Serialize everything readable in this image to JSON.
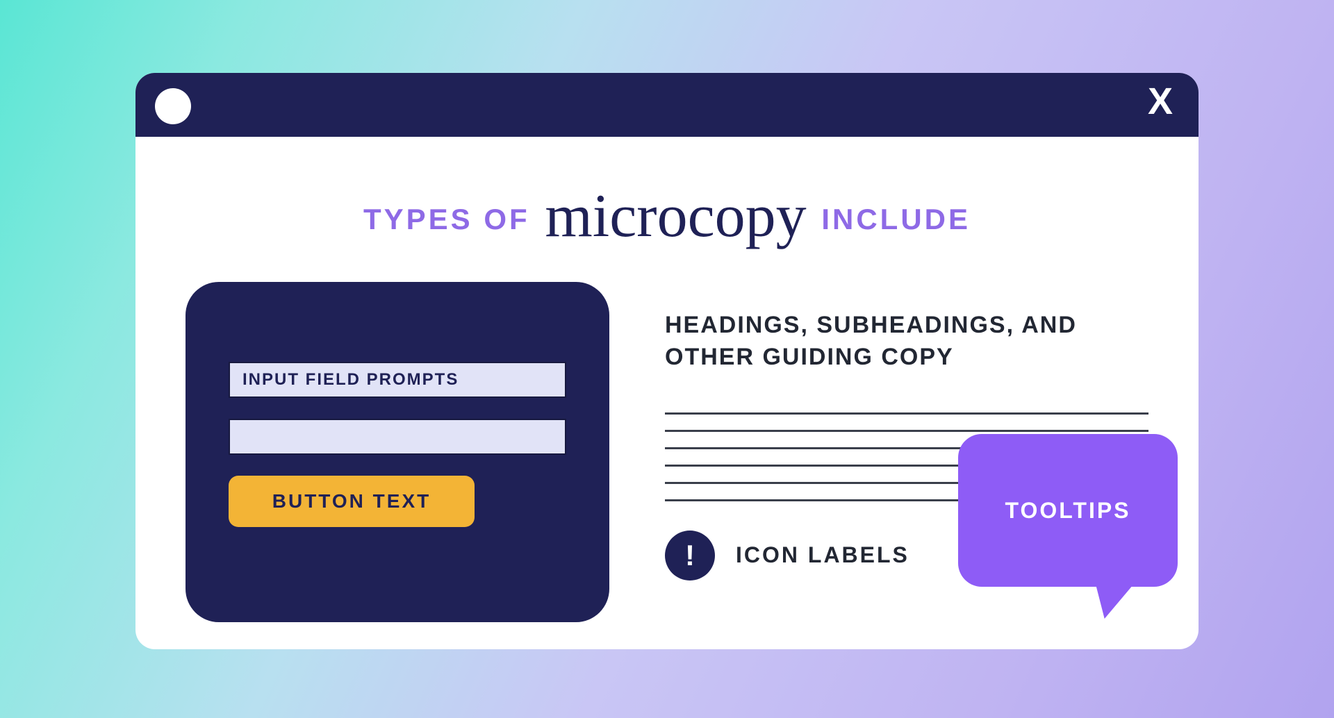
{
  "window": {
    "close_glyph": "X"
  },
  "headline": {
    "prefix": "TYPES OF",
    "script": "microcopy",
    "suffix": "INCLUDE"
  },
  "form": {
    "input1_label": "INPUT FIELD PROMPTS",
    "input2_label": "",
    "button_label": "BUTTON TEXT"
  },
  "right": {
    "heading": "HEADINGS, SUBHEADINGS, AND OTHER GUIDING COPY",
    "icon_glyph": "!",
    "icon_label": "ICON LABELS"
  },
  "tooltip": {
    "label": "TOOLTIPS"
  }
}
